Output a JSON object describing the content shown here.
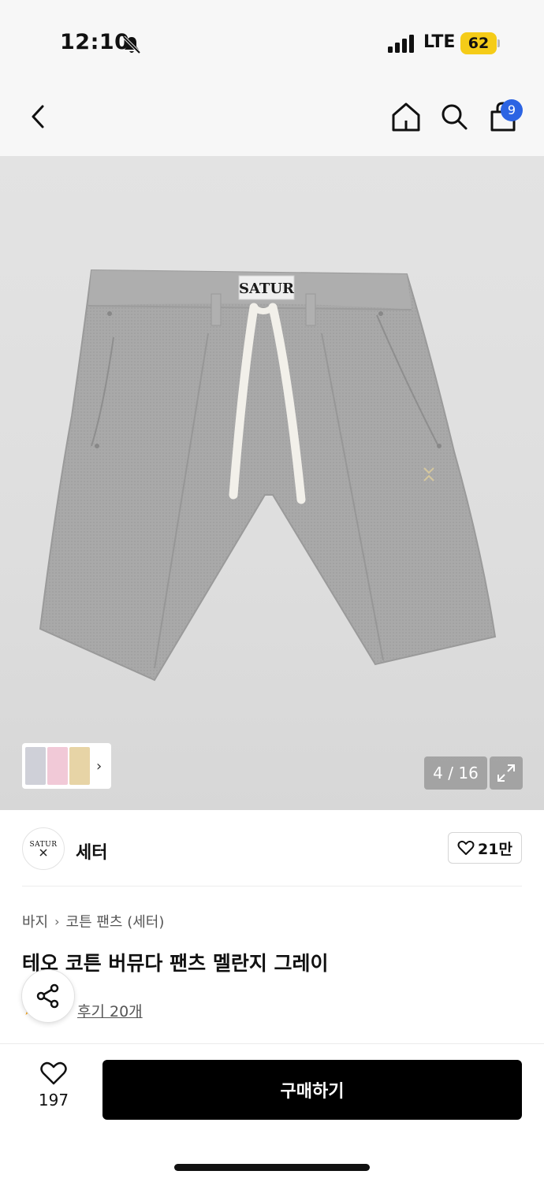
{
  "status": {
    "time": "12:10",
    "network": "LTE",
    "battery": "62"
  },
  "nav": {
    "cart_count": "9"
  },
  "gallery": {
    "counter": "4 / 16",
    "print_label": "SATUR"
  },
  "brand": {
    "name": "세터",
    "logo_text": "SATUR",
    "likes": "21만"
  },
  "product": {
    "breadcrumb": [
      "바지",
      "코튼 팬츠 (세터)"
    ],
    "title": "테오 코튼 버뮤다 팬츠 멜란지 그레이",
    "reviews": "후기 20개"
  },
  "footer": {
    "wish_count": "197",
    "buy_label": "구매하기"
  },
  "colors": {
    "badge": "#2c64e3",
    "battery": "#f5cc18",
    "buy_button": "#000000",
    "rating_star": "#f4a623"
  }
}
